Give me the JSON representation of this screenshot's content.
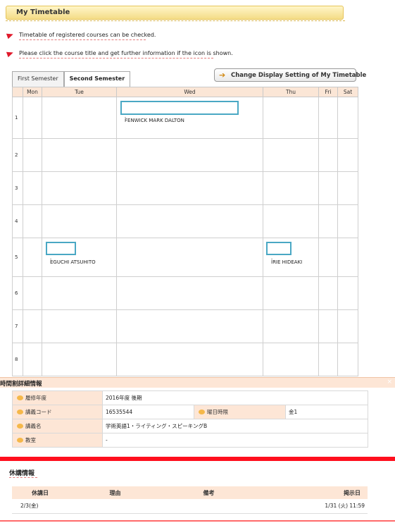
{
  "header": {
    "title": "My Timetable"
  },
  "notices": [
    "Timetable of registered courses can be checked.",
    "Please click the course title and get further information if the icon is shown."
  ],
  "semester_tabs": [
    {
      "label": "First Semester",
      "active": true
    },
    {
      "label": "Second Semester",
      "active": false
    }
  ],
  "display_button": {
    "label": "Change Display Setting of My Timetable"
  },
  "timetable": {
    "days": [
      "Mon",
      "Tue",
      "Wed",
      "Thu",
      "Fri",
      "Sat"
    ],
    "periods": [
      "1",
      "2",
      "3",
      "4",
      "5",
      "6",
      "7",
      "8"
    ],
    "entries": [
      {
        "period": "1",
        "day": "Wed",
        "teacher": "FENWICK MARK DALTON"
      },
      {
        "period": "5",
        "day": "Tue",
        "teacher": "EGUCHI ATSUHITO"
      },
      {
        "period": "5",
        "day": "Thu",
        "teacher": "IRIE HIDEAKI"
      }
    ]
  },
  "detail": {
    "title": "時間割詳細情報",
    "close_icon": "×",
    "fields": {
      "year_label": "履修年度",
      "year_value": "2016年度 後期",
      "code_label": "講義コード",
      "code_value": "16535544",
      "period_label": "曜日時限",
      "period_value": "金1",
      "name_label": "講義名",
      "name_value": "学術英語1・ライティング・スピーキングB",
      "room_label": "教室",
      "room_value": "-"
    }
  },
  "kyuko": {
    "title": "休講情報",
    "headers": [
      "休講日",
      "理由",
      "備考",
      "掲示日"
    ],
    "rows": [
      {
        "date": "2/3(金)",
        "reason": "",
        "note": "",
        "posted": "1/31 (火) 11:59"
      }
    ]
  },
  "colors": {
    "accent": "#e0192b",
    "header_bg": "#fde6d6",
    "course_border": "#4aa8c4"
  }
}
